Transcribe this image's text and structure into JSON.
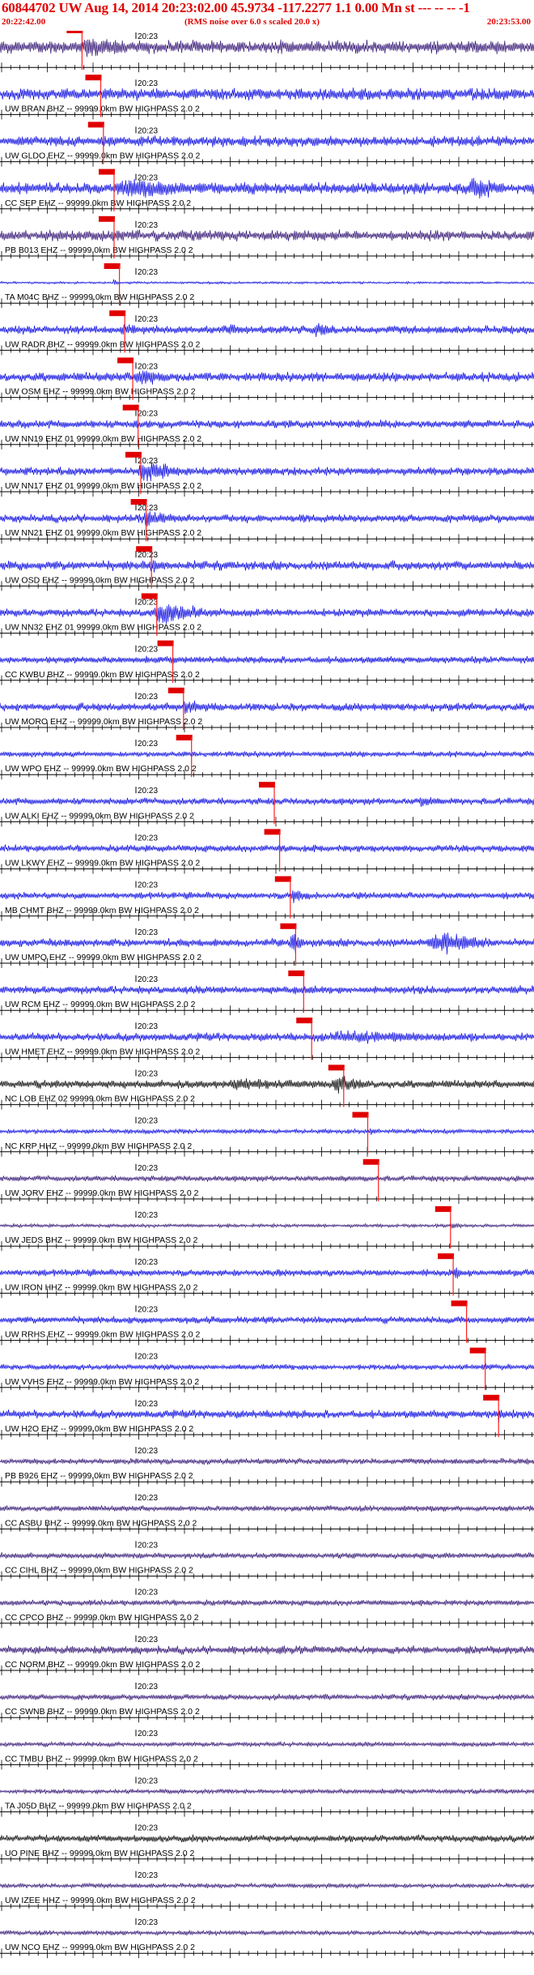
{
  "header": {
    "title": "60844702 UW Aug 14, 2014 20:23:02.00   45.9734 -117.2277  1.1 0.00 Mn st --- -- --  -1",
    "start_time": "20:22:42.00",
    "rms_note": "(RMS noise over 6.0 s scaled 20.0 x)",
    "end_time": "20:23:53.00"
  },
  "time_tick_label": "20:23",
  "colors": {
    "header_red": "#e00000",
    "blue_trace": "#0000e0",
    "purple_trace": "#2a0a6e",
    "black_trace": "#000000",
    "pick_marker": "#e00000",
    "pick_line": "#ff2020"
  },
  "traces": [
    {
      "label": "",
      "color": "purple",
      "pick": 0.14,
      "events": [
        [
          0.13,
          0.35,
          0.9
        ],
        [
          0.35,
          0.6,
          0.35
        ]
      ],
      "noise": 0.55
    },
    {
      "label": "UW BRAN BHZ -- 99999.0km BW  HIGHPASS  2.0  2",
      "color": "blue",
      "pick": 0.175,
      "events": [
        [
          0.17,
          0.28,
          0.4
        ]
      ],
      "noise": 0.5
    },
    {
      "label": "UW GLDO EHZ -- 99999.0km BW  HIGHPASS  2.0  2",
      "color": "blue",
      "pick": 0.18,
      "events": [
        [
          0.18,
          0.25,
          0.5
        ]
      ],
      "noise": 0.45
    },
    {
      "label": "CC SEP EHZ -- 99999.0km BW  HIGHPASS  2.0  2",
      "color": "blue",
      "pick": 0.2,
      "events": [
        [
          0.2,
          0.45,
          1.0
        ],
        [
          0.87,
          0.98,
          1.0
        ]
      ],
      "noise": 0.5
    },
    {
      "label": "PB B013 EHZ -- 99999.0km BW  HIGHPASS  2.0  2",
      "color": "purple",
      "pick": 0.2,
      "events": [
        [
          0.19,
          0.35,
          0.5
        ]
      ],
      "noise": 0.45
    },
    {
      "label": "TA M04C BHZ -- 99999.0km BW  HIGHPASS  2.0  2",
      "color": "blue",
      "pick": 0.21,
      "events": [
        [
          0.21,
          0.23,
          0.3
        ]
      ],
      "noise": 0.1
    },
    {
      "label": "UW RADR BHZ -- 99999.0km BW  HIGHPASS  2.0  2",
      "color": "blue",
      "pick": 0.22,
      "events": [
        [
          0.22,
          0.3,
          0.6
        ],
        [
          0.42,
          0.48,
          0.6
        ],
        [
          0.58,
          0.65,
          0.7
        ]
      ],
      "noise": 0.35
    },
    {
      "label": "UW OSM EHZ -- 99999.0km BW  HIGHPASS  2.0  2",
      "color": "blue",
      "pick": 0.235,
      "events": [
        [
          0.24,
          0.36,
          0.85
        ]
      ],
      "noise": 0.4
    },
    {
      "label": "UW NN19 EHZ 01 99999.0km BW  HIGHPASS  2.0  2",
      "color": "blue",
      "pick": 0.245,
      "events": [
        [
          0.24,
          0.3,
          0.5
        ]
      ],
      "noise": 0.35
    },
    {
      "label": "UW NN17 EHZ 01 99999.0km BW  HIGHPASS  2.0  2",
      "color": "blue",
      "pick": 0.25,
      "events": [
        [
          0.25,
          0.38,
          0.95
        ],
        [
          0.45,
          0.6,
          0.3
        ]
      ],
      "noise": 0.35
    },
    {
      "label": "UW NN21 EHZ 01 99999.0km BW  HIGHPASS  2.0  2",
      "color": "blue",
      "pick": 0.26,
      "events": [
        [
          0.25,
          0.4,
          0.6
        ]
      ],
      "noise": 0.35
    },
    {
      "label": "UW OSD EHZ -- 99999.0km BW  HIGHPASS  2.0  2",
      "color": "blue",
      "pick": 0.27,
      "events": [
        [
          0.27,
          0.35,
          0.6
        ]
      ],
      "noise": 0.4
    },
    {
      "label": "UW NN32 EHZ 01 99999.0km BW  HIGHPASS  2.0  2",
      "color": "blue",
      "pick": 0.28,
      "events": [
        [
          0.27,
          0.45,
          0.95
        ]
      ],
      "noise": 0.35
    },
    {
      "label": "CC KWBU BHZ -- 99999.0km BW  HIGHPASS  2.0  2",
      "color": "blue",
      "pick": 0.31,
      "events": [
        [
          0.31,
          0.37,
          0.4
        ]
      ],
      "noise": 0.3
    },
    {
      "label": "UW MORO EHZ -- 99999.0km BW  HIGHPASS  2.0  2",
      "color": "blue",
      "pick": 0.33,
      "events": [
        [
          0.33,
          0.45,
          0.6
        ]
      ],
      "noise": 0.35
    },
    {
      "label": "UW WPO EHZ -- 99999.0km BW  HIGHPASS  2.0  2",
      "color": "blue",
      "pick": 0.345,
      "events": [
        [
          0.34,
          0.38,
          0.3
        ]
      ],
      "noise": 0.25
    },
    {
      "label": "UW ALKI EHZ -- 99999.0km BW  HIGHPASS  2.0  2",
      "color": "blue",
      "pick": 0.5,
      "events": [
        [
          0.78,
          0.84,
          0.6
        ]
      ],
      "noise": 0.3
    },
    {
      "label": "UW LKWY EHZ -- 99999.0km BW  HIGHPASS  2.0  2",
      "color": "blue",
      "pick": 0.51,
      "events": [
        [
          0.52,
          0.56,
          0.3
        ]
      ],
      "noise": 0.3
    },
    {
      "label": "MB CHMT BHZ -- 99999.0km BW  HIGHPASS  2.0  2",
      "color": "blue",
      "pick": 0.53,
      "events": [
        [
          0.54,
          0.6,
          0.7
        ]
      ],
      "noise": 0.3
    },
    {
      "label": "UW UMPQ EHZ -- 99999.0km BW  HIGHPASS  2.0  2",
      "color": "blue",
      "pick": 0.54,
      "events": [
        [
          0.54,
          0.58,
          1.0
        ],
        [
          0.79,
          0.97,
          1.0
        ]
      ],
      "noise": 0.35
    },
    {
      "label": "UW RCM EHZ -- 99999.0km BW  HIGHPASS  2.0  2",
      "color": "blue",
      "pick": 0.555,
      "events": [
        [
          0.56,
          0.62,
          0.35
        ]
      ],
      "noise": 0.35
    },
    {
      "label": "UW HMET EHZ -- 99999.0km BW  HIGHPASS  2.0  2",
      "color": "blue",
      "pick": 0.57,
      "events": [
        [
          0.58,
          0.99,
          0.6
        ]
      ],
      "noise": 0.35
    },
    {
      "label": "NC LOB EHZ 02 99999.0km BW  HIGHPASS  2.0  2",
      "color": "black",
      "pick": 0.63,
      "events": [
        [
          0.4,
          0.7,
          0.55
        ],
        [
          0.62,
          0.7,
          1.0
        ]
      ],
      "noise": 0.35
    },
    {
      "label": "NC KRP HHZ -- 99999.0km BW  HIGHPASS  2.0  2",
      "color": "blue",
      "pick": 0.675,
      "events": [
        [
          0.69,
          0.71,
          0.45
        ]
      ],
      "noise": 0.2
    },
    {
      "label": "UW JORV EHZ -- 99999.0km BW  HIGHPASS  2.0  2",
      "color": "purple",
      "pick": 0.695,
      "events": [
        [
          0.7,
          0.72,
          0.2
        ]
      ],
      "noise": 0.25
    },
    {
      "label": "UW JEDS BHZ -- 99999.0km BW  HIGHPASS  2.0  2",
      "color": "purple",
      "pick": 0.83,
      "events": [
        [
          0.84,
          0.88,
          0.3
        ]
      ],
      "noise": 0.15
    },
    {
      "label": "UW IRON HHZ -- 99999.0km BW  HIGHPASS  2.0  2",
      "color": "blue",
      "pick": 0.835,
      "events": [
        [
          0.85,
          0.87,
          0.8
        ]
      ],
      "noise": 0.3
    },
    {
      "label": "UW RRHS EHZ -- 99999.0km BW  HIGHPASS  2.0  2",
      "color": "blue",
      "pick": 0.86,
      "events": [
        [
          0.86,
          0.88,
          0.5
        ]
      ],
      "noise": 0.3
    },
    {
      "label": "UW VVHS EHZ -- 99999.0km BW  HIGHPASS  2.0  2",
      "color": "blue",
      "pick": 0.895,
      "events": [
        [
          0.9,
          0.93,
          0.5
        ]
      ],
      "noise": 0.25
    },
    {
      "label": "UW H2O EHZ -- 99999.0km BW  HIGHPASS  2.0  2",
      "color": "blue",
      "pick": 0.92,
      "events": [
        [
          0.93,
          0.95,
          0.8
        ]
      ],
      "noise": 0.35
    },
    {
      "label": "PB B926 EHZ -- 99999.0km BW  HIGHPASS  2.0  2",
      "color": "purple",
      "pick": null,
      "events": [],
      "noise": 0.25
    },
    {
      "label": "CC ASBU BHZ -- 99999.0km BW  HIGHPASS  2.0  2",
      "color": "purple",
      "pick": null,
      "events": [],
      "noise": 0.25
    },
    {
      "label": "CC CIHL BHZ -- 99999.0km BW  HIGHPASS  2.0  2",
      "color": "purple",
      "pick": null,
      "events": [],
      "noise": 0.25
    },
    {
      "label": "CC CPCO BHZ -- 99999.0km BW  HIGHPASS  2.0  2",
      "color": "purple",
      "pick": null,
      "events": [],
      "noise": 0.25
    },
    {
      "label": "CC NORM BHZ -- 99999.0km BW  HIGHPASS  2.0  2",
      "color": "purple",
      "pick": null,
      "events": [
        [
          0.25,
          0.3,
          0.3
        ]
      ],
      "noise": 0.35
    },
    {
      "label": "CC SWNB BHZ -- 99999.0km BW  HIGHPASS  2.0  2",
      "color": "purple",
      "pick": null,
      "events": [],
      "noise": 0.25
    },
    {
      "label": "CC TMBU BHZ -- 99999.0km BW  HIGHPASS  2.0  2",
      "color": "purple",
      "pick": null,
      "events": [],
      "noise": 0.2
    },
    {
      "label": "TA J05D BHZ -- 99999.0km BW  HIGHPASS  2.0  2",
      "color": "purple",
      "pick": null,
      "events": [],
      "noise": 0.2
    },
    {
      "label": "UO PINE BHZ -- 99999.0km BW  HIGHPASS  2.0  2",
      "color": "black",
      "pick": null,
      "events": [],
      "noise": 0.3
    },
    {
      "label": "UW IZEE HHZ -- 99999.0km BW  HIGHPASS  2.0  2",
      "color": "purple",
      "pick": null,
      "events": [],
      "noise": 0.2
    },
    {
      "label": "UW NCO EHZ -- 99999.0km BW  HIGHPASS  2.0  2",
      "color": "purple",
      "pick": null,
      "events": [],
      "noise": 0.2
    }
  ]
}
